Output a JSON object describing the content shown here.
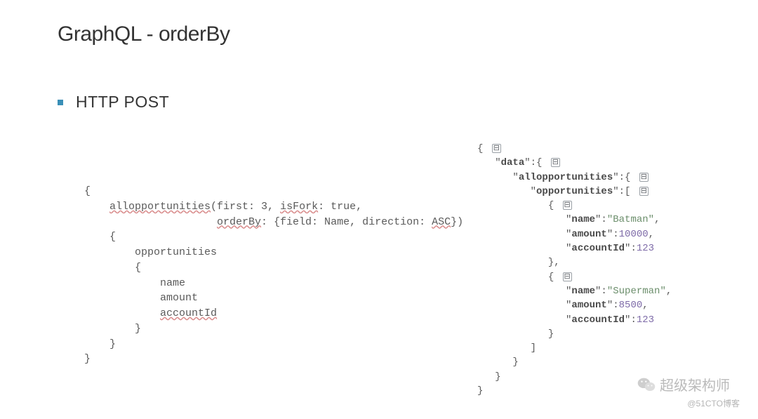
{
  "title": "GraphQL - orderBy",
  "bullet": "HTTP POST",
  "code_left": {
    "l1": "{",
    "l2a": "    ",
    "l2b": "allopportunities",
    "l2c": "(first: 3, ",
    "l2d": "isFork",
    "l2e": ": true,",
    "l3a": "                     ",
    "l3b": "orderBy",
    "l3c": ": {field: Name, direction: ",
    "l3d": "ASC",
    "l3e": "})",
    "l4": "    {",
    "l5": "        opportunities",
    "l6": "        {",
    "l7": "            name",
    "l8": "            amount",
    "l9a": "            ",
    "l9b": "accountId",
    "l10": "        }",
    "l11": "    }",
    "l12": "}"
  },
  "code_right": {
    "r1a": "{ ",
    "r2a": "   \"",
    "r2b": "data",
    "r2c": "\":{ ",
    "r3a": "      \"",
    "r3b": "allopportunities",
    "r3c": "\":{ ",
    "r4a": "         \"",
    "r4b": "opportunities",
    "r4c": "\":[ ",
    "r5a": "            { ",
    "r6a": "               \"",
    "r6b": "name",
    "r6c": "\":",
    "r6d": "\"Batman\"",
    "r6e": ",",
    "r7a": "               \"",
    "r7b": "amount",
    "r7c": "\":",
    "r7d": "10000",
    "r7e": ",",
    "r8a": "               \"",
    "r8b": "accountId",
    "r8c": "\":",
    "r8d": "123",
    "r9a": "            },",
    "r10a": "            { ",
    "r11a": "               \"",
    "r11b": "name",
    "r11c": "\":",
    "r11d": "\"Superman\"",
    "r11e": ",",
    "r12a": "               \"",
    "r12b": "amount",
    "r12c": "\":",
    "r12d": "8500",
    "r12e": ",",
    "r13a": "               \"",
    "r13b": "accountId",
    "r13c": "\":",
    "r13d": "123",
    "r14a": "            }",
    "r15a": "         ]",
    "r16a": "      }",
    "r17a": "   }",
    "r18a": "}"
  },
  "toggle_glyph": "⊟",
  "watermark_text": "超级架构师",
  "watermark_blog": "@51CTO博客"
}
